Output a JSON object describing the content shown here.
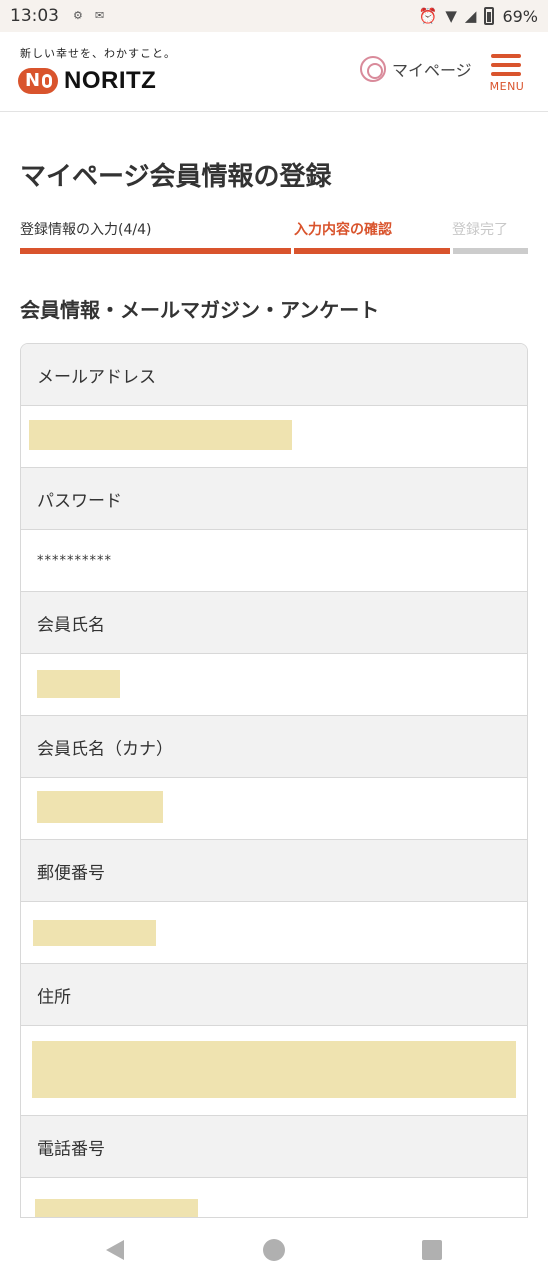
{
  "status_bar": {
    "time": "13:03",
    "battery": "69%"
  },
  "header": {
    "tagline": "新しい幸せを、わかすこと。",
    "logo_text": "NORITZ",
    "mypage_label": "マイページ",
    "menu_label": "MENU"
  },
  "page": {
    "title": "マイページ会員情報の登録"
  },
  "stepper": {
    "steps": [
      {
        "label": "登録情報の入力(4/4)",
        "state": "done"
      },
      {
        "label": "入力内容の確認",
        "state": "current"
      },
      {
        "label": "登録完了",
        "state": "pending"
      }
    ],
    "colors": {
      "active": "#d9542d",
      "inactive": "#cccccc",
      "pending_text": "#c8c8c8"
    }
  },
  "section": {
    "title": "会員情報・メールマガジン・アンケート"
  },
  "fields": [
    {
      "label": "メールアドレス",
      "value": ""
    },
    {
      "label": "パスワード",
      "value": "**********"
    },
    {
      "label": "会員氏名",
      "value": ""
    },
    {
      "label": "会員氏名（カナ）",
      "value": ""
    },
    {
      "label": "郵便番号",
      "value": ""
    },
    {
      "label": "住所",
      "value": ""
    },
    {
      "label": "電話番号",
      "value": ""
    }
  ],
  "colors": {
    "accent": "#d9542d",
    "redaction": "#efe3b0",
    "row_header_bg": "#f2f2f2"
  }
}
